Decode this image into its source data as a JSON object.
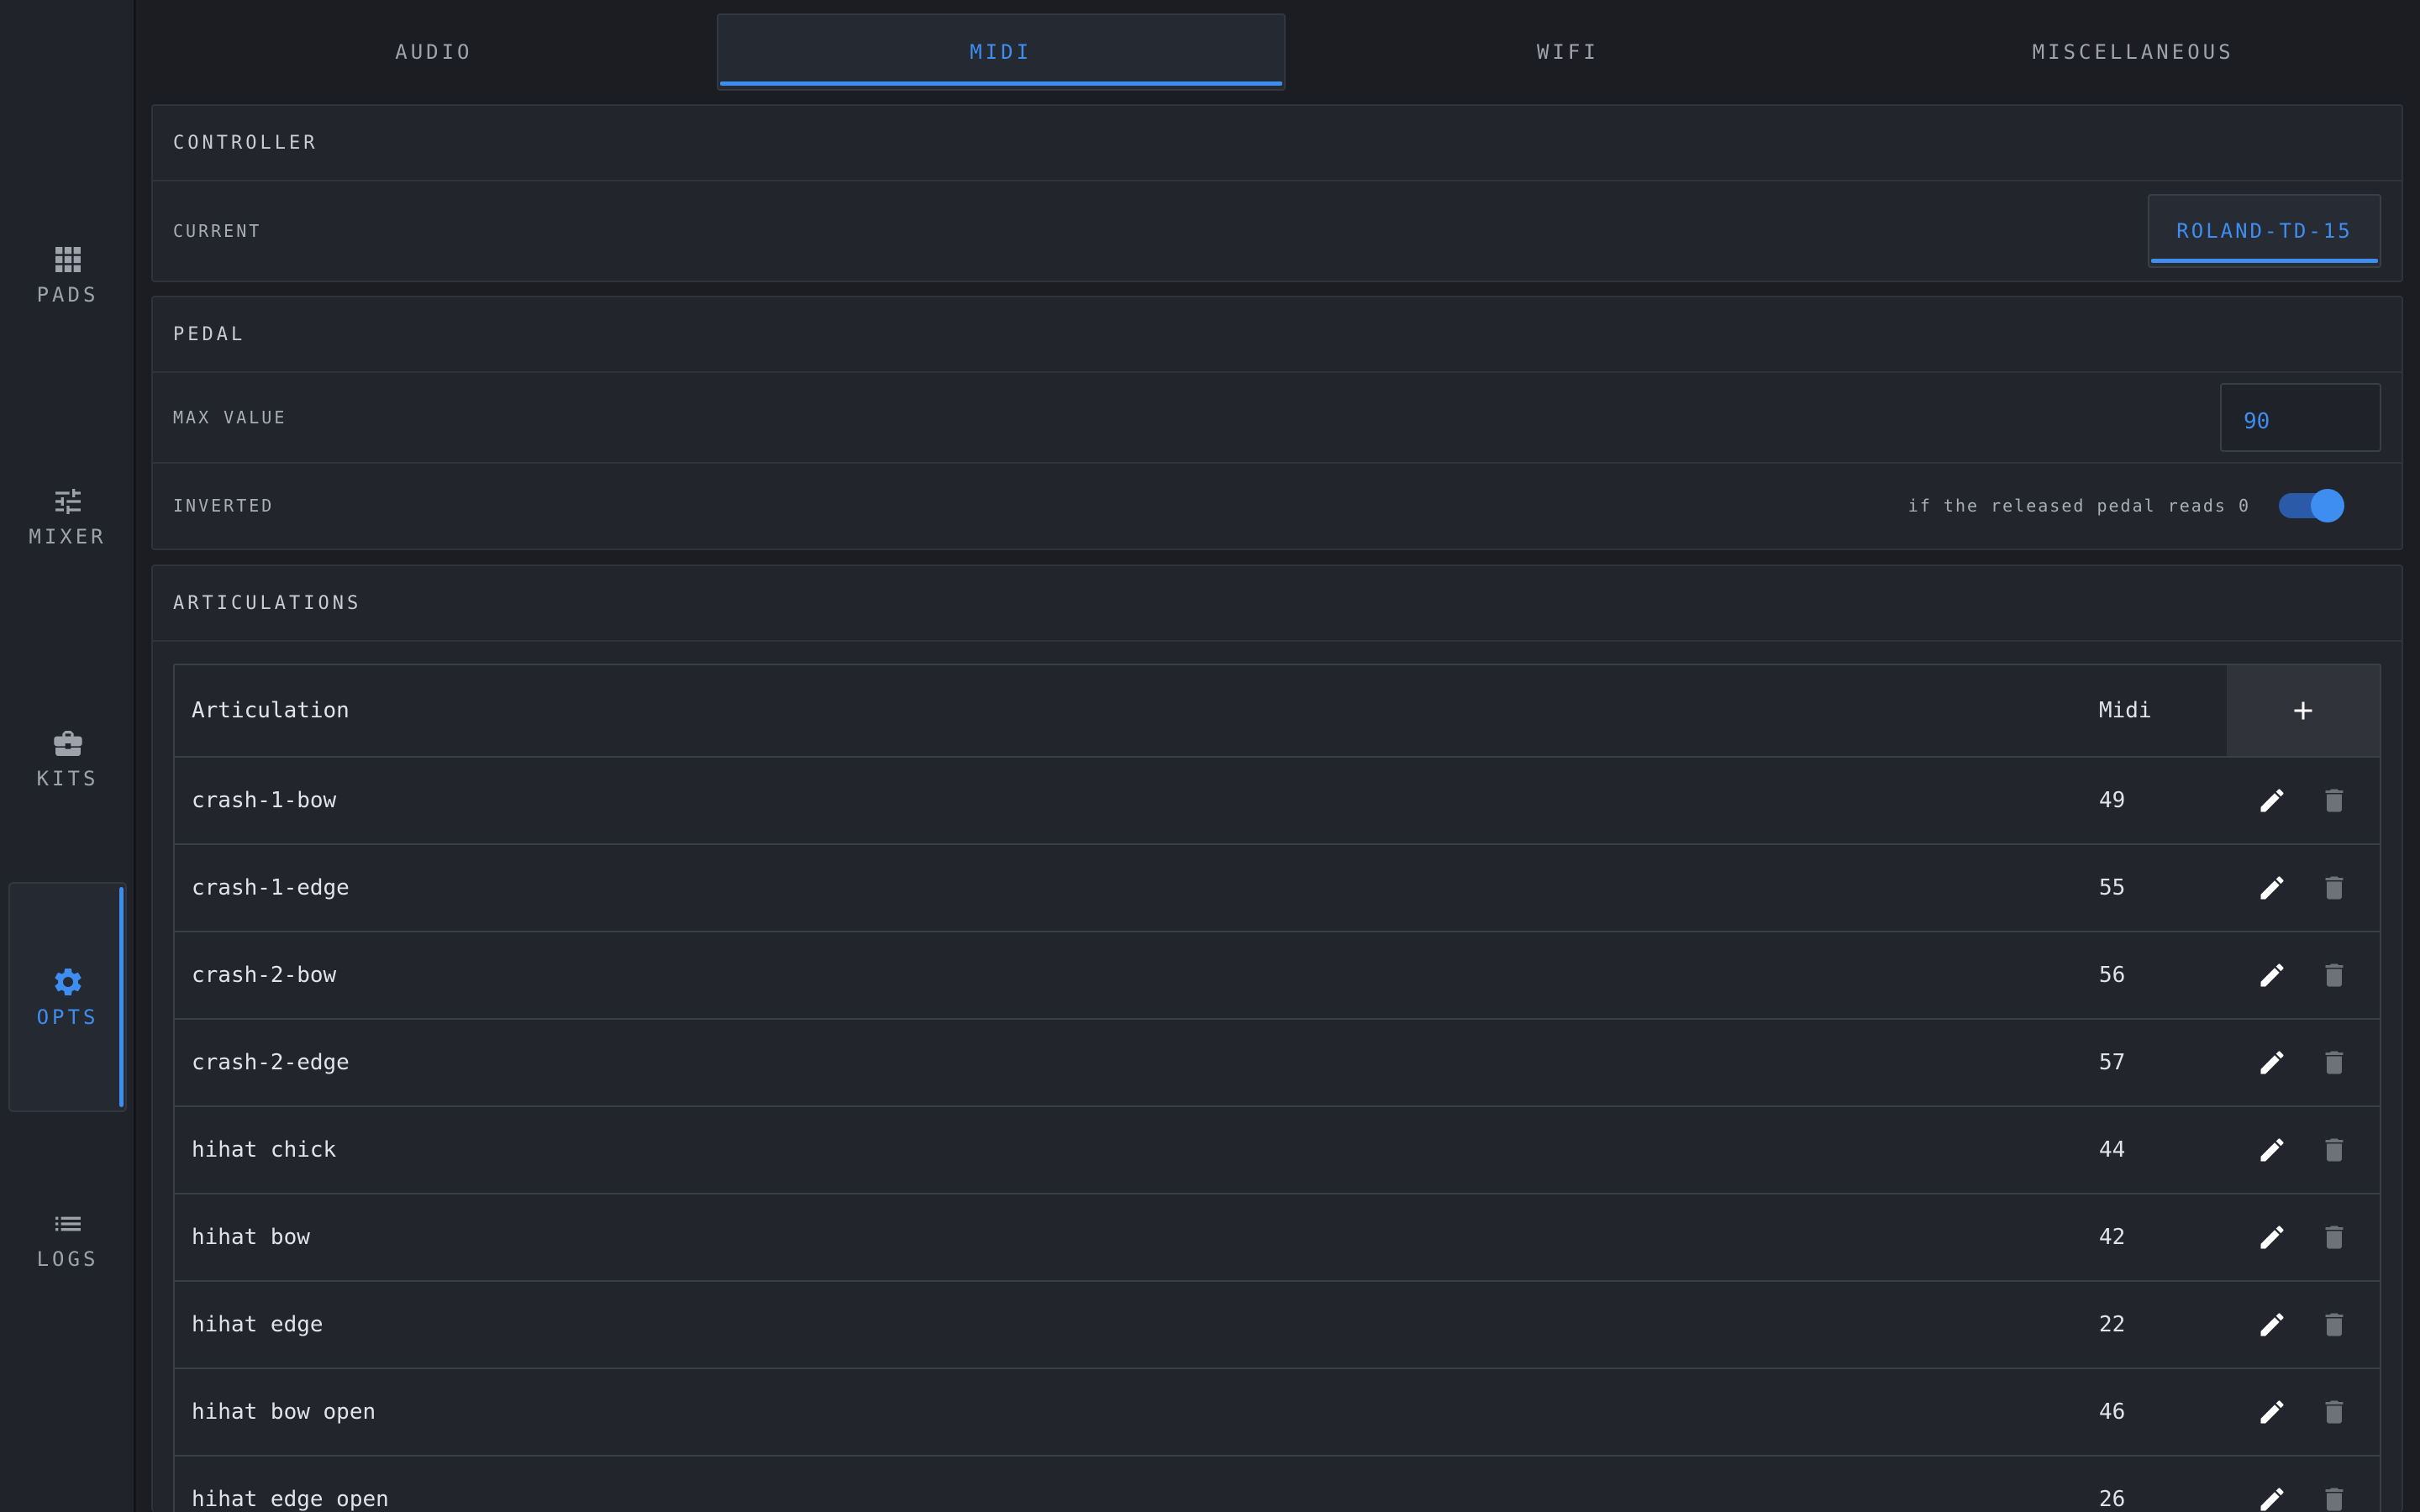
{
  "sidebar": {
    "items": [
      {
        "label": "PADS",
        "icon": "grid-icon"
      },
      {
        "label": "MIXER",
        "icon": "sliders-icon"
      },
      {
        "label": "KITS",
        "icon": "briefcase-icon"
      },
      {
        "label": "OPTS",
        "icon": "gear-icon",
        "active": true
      },
      {
        "label": "LOGS",
        "icon": "list-icon"
      }
    ]
  },
  "tabs": [
    {
      "label": "AUDIO"
    },
    {
      "label": "MIDI",
      "active": true
    },
    {
      "label": "WIFI"
    },
    {
      "label": "MISCELLANEOUS"
    }
  ],
  "controller": {
    "title": "CONTROLLER",
    "current_label": "CURRENT",
    "current_value": "ROLAND-TD-15"
  },
  "pedal": {
    "title": "PEDAL",
    "max_label": "MAX VALUE",
    "max_value": "90",
    "inverted_label": "INVERTED",
    "inverted_hint": "if the released pedal reads 0",
    "inverted_on": true
  },
  "articulations": {
    "title": "ARTICULATIONS",
    "col_name": "Articulation",
    "col_midi": "Midi",
    "rows": [
      {
        "name": "crash-1-bow",
        "midi": "49"
      },
      {
        "name": "crash-1-edge",
        "midi": "55"
      },
      {
        "name": "crash-2-bow",
        "midi": "56"
      },
      {
        "name": "crash-2-edge",
        "midi": "57"
      },
      {
        "name": "hihat chick",
        "midi": "44"
      },
      {
        "name": "hihat bow",
        "midi": "42"
      },
      {
        "name": "hihat edge",
        "midi": "22"
      },
      {
        "name": "hihat bow open",
        "midi": "46"
      },
      {
        "name": "hihat edge open",
        "midi": "26"
      }
    ]
  },
  "colors": {
    "accent": "#3d8ef0",
    "background": "#1b1d22",
    "panel": "#22252c",
    "sidebar": "#20232a"
  }
}
